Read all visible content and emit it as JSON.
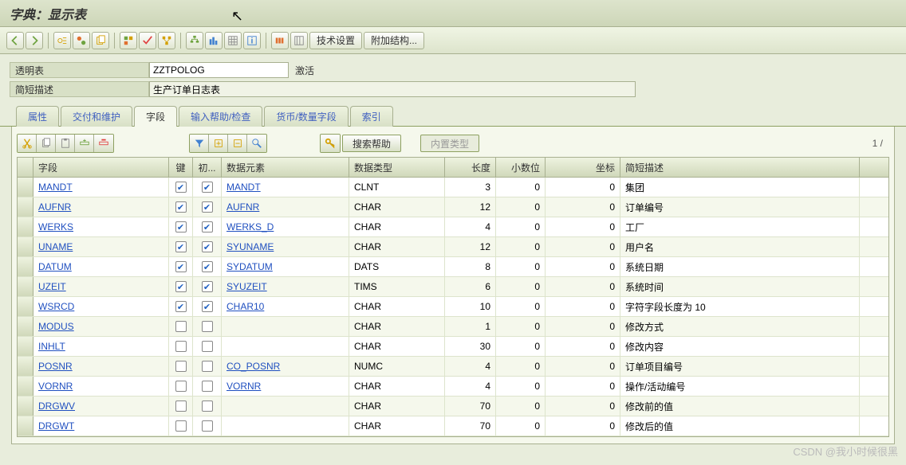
{
  "title": "字典：显示表",
  "toolbar": {
    "tech_settings": "技术设置",
    "add_structure": "附加结构..."
  },
  "form": {
    "table_label": "透明表",
    "table_value": "ZZTPOLOG",
    "status": "激活",
    "desc_label": "简短描述",
    "desc_value": "生产订单日志表"
  },
  "tabs": {
    "t0": "属性",
    "t1": "交付和维护",
    "t2": "字段",
    "t3": "输入帮助/检查",
    "t4": "货币/数量字段",
    "t5": "索引"
  },
  "subtoolbar": {
    "search_help": "搜索帮助",
    "builtin_type": "内置类型"
  },
  "pager": "1 /",
  "columns": {
    "field": "字段",
    "key": "键",
    "init": "初...",
    "elem": "数据元素",
    "type": "数据类型",
    "len": "长度",
    "dec": "小数位",
    "coord": "坐标",
    "desc": "简短描述"
  },
  "rows": [
    {
      "field": "MANDT",
      "key": true,
      "init": true,
      "elem": "MANDT",
      "type": "CLNT",
      "len": "3",
      "dec": "0",
      "coord": "0",
      "desc": "集团"
    },
    {
      "field": "AUFNR",
      "key": true,
      "init": true,
      "elem": "AUFNR",
      "type": "CHAR",
      "len": "12",
      "dec": "0",
      "coord": "0",
      "desc": "订单编号"
    },
    {
      "field": "WERKS",
      "key": true,
      "init": true,
      "elem": "WERKS_D",
      "type": "CHAR",
      "len": "4",
      "dec": "0",
      "coord": "0",
      "desc": "工厂"
    },
    {
      "field": "UNAME",
      "key": true,
      "init": true,
      "elem": "SYUNAME",
      "type": "CHAR",
      "len": "12",
      "dec": "0",
      "coord": "0",
      "desc": "用户名"
    },
    {
      "field": "DATUM",
      "key": true,
      "init": true,
      "elem": "SYDATUM",
      "type": "DATS",
      "len": "8",
      "dec": "0",
      "coord": "0",
      "desc": "系统日期"
    },
    {
      "field": "UZEIT",
      "key": true,
      "init": true,
      "elem": "SYUZEIT",
      "type": "TIMS",
      "len": "6",
      "dec": "0",
      "coord": "0",
      "desc": "系统时间"
    },
    {
      "field": "WSRCD",
      "key": true,
      "init": true,
      "elem": "CHAR10",
      "type": "CHAR",
      "len": "10",
      "dec": "0",
      "coord": "0",
      "desc": "字符字段长度为 10"
    },
    {
      "field": "MODUS",
      "key": false,
      "init": false,
      "elem": "",
      "type": "CHAR",
      "len": "1",
      "dec": "0",
      "coord": "0",
      "desc": "修改方式"
    },
    {
      "field": "INHLT",
      "key": false,
      "init": false,
      "elem": "",
      "type": "CHAR",
      "len": "30",
      "dec": "0",
      "coord": "0",
      "desc": "修改内容"
    },
    {
      "field": "POSNR",
      "key": false,
      "init": false,
      "elem": "CO_POSNR",
      "type": "NUMC",
      "len": "4",
      "dec": "0",
      "coord": "0",
      "desc": "订单项目编号"
    },
    {
      "field": "VORNR",
      "key": false,
      "init": false,
      "elem": "VORNR",
      "type": "CHAR",
      "len": "4",
      "dec": "0",
      "coord": "0",
      "desc": "操作/活动编号"
    },
    {
      "field": "DRGWV",
      "key": false,
      "init": false,
      "elem": "",
      "type": "CHAR",
      "len": "70",
      "dec": "0",
      "coord": "0",
      "desc": "修改前的值"
    },
    {
      "field": "DRGWT",
      "key": false,
      "init": false,
      "elem": "",
      "type": "CHAR",
      "len": "70",
      "dec": "0",
      "coord": "0",
      "desc": "修改后的值"
    }
  ],
  "watermark": "CSDN @我小时候很黑"
}
